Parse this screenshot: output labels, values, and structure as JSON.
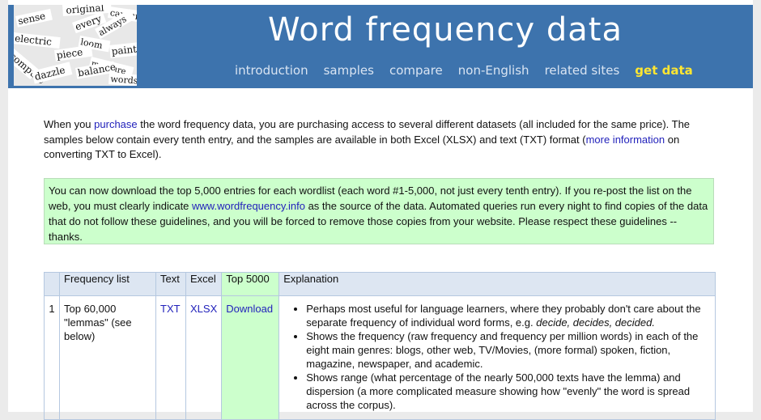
{
  "header": {
    "title": "Word frequency data",
    "nav": [
      "introduction",
      "samples",
      "compare",
      "non-English",
      "related sites",
      "get data"
    ]
  },
  "intro": {
    "p1": "When you ",
    "link1": "purchase",
    "p2": " the word frequency data, you are purchasing access to several different datasets (all included for the same price). The samples below contain every tenth entry, and the samples are available in both Excel (XLSX) and text (TXT) format (",
    "link2": "more information",
    "p3": " on converting TXT to Excel)."
  },
  "notice": {
    "p1": "You can now download the top 5,000 entries for each wordlist (each word #1-5,000, not just every tenth entry). If you re-post the list on the web, you must clearly indicate ",
    "link": "www.wordfrequency.info",
    "p2": " as the source of the data. Automated queries run every night to find copies of the data that do not follow these guidelines, and you will be forced to remove those copies from your website. Please respect these guidelines -- thanks."
  },
  "table": {
    "headers": [
      "",
      "Frequency list",
      "Text",
      "Excel",
      "Top 5000",
      "Explanation"
    ],
    "row1": {
      "num": "1",
      "list": "Top 60,000 \"lemmas\" (see below)",
      "text": "TXT",
      "excel": "XLSX",
      "top": "Download",
      "b1a": "Perhaps most useful for language learners, where they probably don't care about the separate frequency of individual word forms, e.g. ",
      "b1b": "decide, decides, decided.",
      "b2": "Shows the frequency (raw frequency and frequency per million words) in each of the eight main genres: blogs, other web, TV/Movies, (more formal) spoken, fiction, magazine, newspaper, and academic.",
      "b3": "Shows range (what percentage of the nearly 500,000 texts have the lemma) and dispersion (a more complicated measure showing how \"evenly\" the word is spread across the corpus)."
    }
  },
  "logo_words": [
    "original",
    "capture",
    "sense",
    "every",
    "electric",
    "loom",
    "compute",
    "piece",
    "paint",
    "always",
    "measure",
    "dazzle",
    "balance",
    "words"
  ],
  "colors": {
    "header": "#3d73ad",
    "nav_highlight": "#ffe631",
    "notice_bg": "#ccffcc",
    "table_header": "#dde6f2",
    "link": "#2222bb"
  }
}
